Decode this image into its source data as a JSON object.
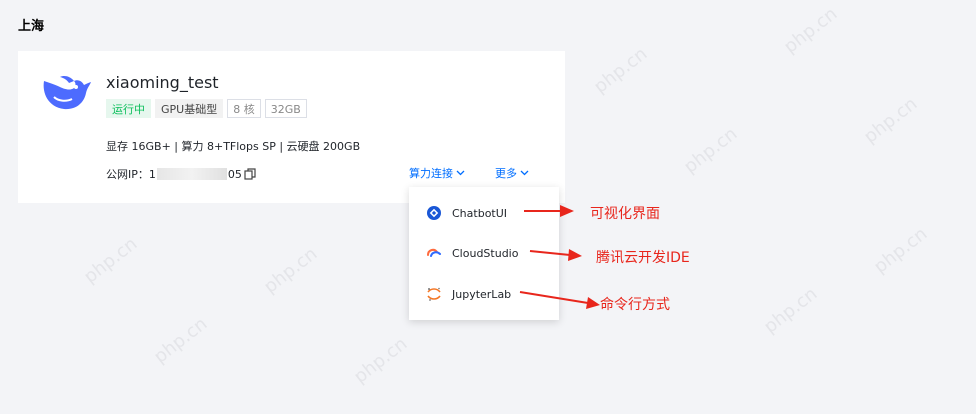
{
  "region": "上海",
  "instance": {
    "name": "xiaoming_test",
    "tags": [
      "运行中",
      "GPU基础型",
      "8 核",
      "32GB"
    ],
    "specs": "显存 16GB+ | 算力 8+TFlops SP | 云硬盘 200GB",
    "ip_label": "公网IP：",
    "ip_prefix": "1",
    "ip_suffix": "05",
    "compute_menu": "算力连接",
    "more_menu": "更多"
  },
  "dropdown": {
    "items": [
      {
        "label": "ChatbotUI",
        "icon": "chatbotui-icon"
      },
      {
        "label": "CloudStudio",
        "icon": "cloudstudio-icon"
      },
      {
        "label": "JupyterLab",
        "icon": "jupyter-icon"
      }
    ]
  },
  "annotations": [
    "可视化界面",
    "腾讯云开发IDE",
    "命令行方式"
  ],
  "watermark": "php.cn",
  "colors": {
    "accent": "#006eff",
    "annotation": "#e8261c",
    "running": "#0abf5b",
    "logo": "#4d6bfe"
  }
}
